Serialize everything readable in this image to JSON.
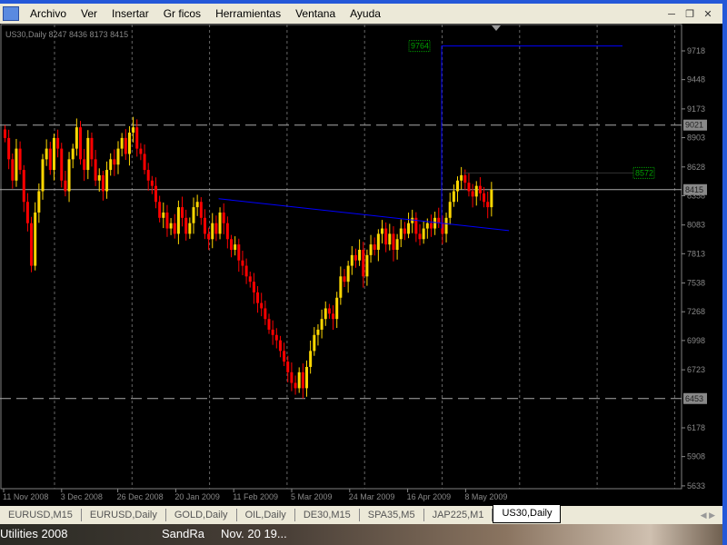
{
  "menu": {
    "items": [
      "Archivo",
      "Ver",
      "Insertar",
      "Gr ficos",
      "Herramientas",
      "Ventana",
      "Ayuda"
    ],
    "window_buttons": [
      "minimize",
      "restore",
      "close"
    ]
  },
  "chart": {
    "header": "US30,Daily  8247 8436 8173 8415",
    "price_ticks": [
      9718,
      9448,
      9173,
      8903,
      8628,
      8358,
      8083,
      7813,
      7538,
      7268,
      6998,
      6723,
      6178,
      5908,
      5633
    ],
    "date_ticks": [
      "11 Nov 2008",
      "3 Dec 2008",
      "26 Dec 2008",
      "20 Jan 2009",
      "11 Feb 2009",
      "5 Mar 2009",
      "24 Mar 2009",
      "16 Apr 2009",
      "8 May 2009"
    ],
    "levels": [
      {
        "value": "9021",
        "price": 9021,
        "style": "dashed"
      },
      {
        "value": "8415",
        "price": 8415,
        "style": "solid"
      },
      {
        "value": "6453",
        "price": 6453,
        "style": "dashed"
      }
    ],
    "markers": [
      {
        "label": "9764",
        "price": 9764
      },
      {
        "label": "8572",
        "price": 8572
      }
    ],
    "trendline": {
      "from_bar": 57,
      "from_price": 8330,
      "to_bar": 134,
      "to_price": 8030
    },
    "colors": {
      "bull": "#ffd700",
      "bear": "#ff0000",
      "line": "#0000ff",
      "marker": "#00a000",
      "grid": "#808080"
    },
    "closes": [
      8900,
      8700,
      8500,
      8800,
      8600,
      8300,
      8100,
      7700,
      8200,
      8400,
      8700,
      8800,
      8600,
      8900,
      8800,
      8500,
      8400,
      8700,
      8800,
      9000,
      8700,
      8600,
      8900,
      8700,
      8500,
      8550,
      8400,
      8600,
      8700,
      8650,
      8800,
      8900,
      8750,
      8950,
      9000,
      8800,
      8750,
      8600,
      8500,
      8450,
      8300,
      8150,
      8200,
      8050,
      8100,
      8000,
      8250,
      8150,
      8000,
      8100,
      8250,
      8300,
      8150,
      8000,
      7950,
      8100,
      8000,
      8200,
      8100,
      7950,
      7850,
      7900,
      7750,
      7700,
      7600,
      7550,
      7450,
      7350,
      7300,
      7200,
      7100,
      7050,
      7000,
      6900,
      6800,
      6700,
      6600,
      6550,
      6700,
      6550,
      6750,
      6900,
      7050,
      7100,
      7200,
      7300,
      7250,
      7200,
      7400,
      7600,
      7550,
      7700,
      7800,
      7750,
      7850,
      7600,
      7800,
      7900,
      7850,
      8000,
      8050,
      7900,
      8000,
      7850,
      7950,
      8050,
      8000,
      8100,
      8150,
      8000,
      7950,
      8050,
      8100,
      8050,
      8150,
      8100,
      8000,
      8150,
      8300,
      8400,
      8500,
      8550,
      8480,
      8400,
      8350,
      8450,
      8380,
      8300,
      8250,
      8415
    ]
  },
  "tabs": [
    "EURUSD,M15",
    "EURUSD,Daily",
    "GOLD,Daily",
    "OIL,Daily",
    "DE30,M15",
    "SPA35,M5",
    "JAP225,M1",
    "US30,Daily"
  ],
  "active_tab": "US30,Daily",
  "taskbar": {
    "items": [
      "Utilities 2008",
      "SandRa",
      "Nov. 20 19..."
    ]
  }
}
